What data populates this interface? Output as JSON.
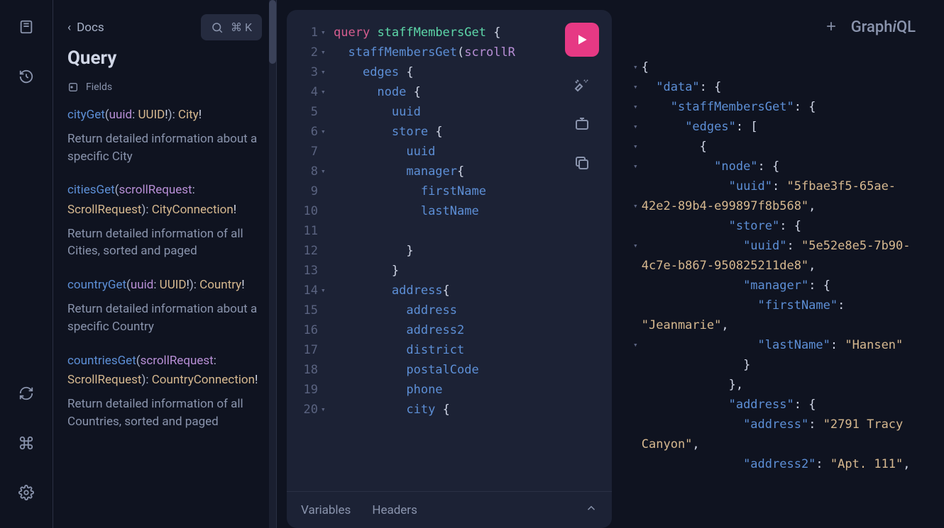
{
  "rail": {
    "items": [
      "book-icon",
      "history-icon"
    ],
    "bottom": [
      "refresh-icon",
      "command-icon",
      "gear-icon"
    ]
  },
  "docs": {
    "back_label": "Docs",
    "search_shortcut": "⌘ K",
    "title": "Query",
    "fields_label": "Fields",
    "entries": [
      {
        "name": "cityGet",
        "arg": "uuid",
        "argType": "UUID",
        "argBang": "!",
        "ret": "City",
        "retBang": "!",
        "desc": "Return detailed information about a specific City"
      },
      {
        "name": "citiesGet",
        "arg": "scrollRequest",
        "argType": "ScrollRequest",
        "argBang": "",
        "ret": "CityConnection",
        "retBang": "!",
        "desc": "Return detailed information of all Cities, sorted and paged"
      },
      {
        "name": "countryGet",
        "arg": "uuid",
        "argType": "UUID",
        "argBang": "!",
        "ret": "Country",
        "retBang": "!",
        "desc": "Return detailed information about a specific Country"
      },
      {
        "name": "countriesGet",
        "arg": "scrollRequest",
        "argType": "ScrollRequest",
        "argBang": "",
        "ret": "CountryConnection",
        "retBang": "!",
        "desc": "Return detailed information of all Countries, sorted and paged"
      }
    ]
  },
  "editor": {
    "lines": [
      {
        "n": 1,
        "fold": "▾",
        "html": "<span class='kw-query'>query</span> <span class='kw-name'>staffMembersGet</span> <span class='kw-brace'>{</span>"
      },
      {
        "n": 2,
        "fold": "▾",
        "html": "  <span class='kw-field'>staffMembersGet</span>(<span class='kw-arg'>scrollR</span>"
      },
      {
        "n": 3,
        "fold": "▾",
        "html": "    <span class='kw-field'>edges</span> <span class='kw-brace'>{</span>"
      },
      {
        "n": 4,
        "fold": "▾",
        "html": "      <span class='kw-field'>node</span> <span class='kw-brace'>{</span>"
      },
      {
        "n": 5,
        "fold": "",
        "html": "        <span class='kw-field'>uuid</span>"
      },
      {
        "n": 6,
        "fold": "▾",
        "html": "        <span class='kw-field'>store</span> <span class='kw-brace'>{</span>"
      },
      {
        "n": 7,
        "fold": "",
        "html": "          <span class='kw-field'>uuid</span>"
      },
      {
        "n": 8,
        "fold": "▾",
        "html": "          <span class='kw-field'>manager</span><span class='kw-brace'>{</span>"
      },
      {
        "n": 9,
        "fold": "",
        "html": "            <span class='kw-field'>firstName</span>"
      },
      {
        "n": 10,
        "fold": "",
        "html": "            <span class='kw-field'>lastName</span>"
      },
      {
        "n": 11,
        "fold": "",
        "html": ""
      },
      {
        "n": 12,
        "fold": "",
        "html": "          <span class='kw-brace'>}</span>"
      },
      {
        "n": 13,
        "fold": "",
        "html": "        <span class='kw-brace'>}</span>"
      },
      {
        "n": 14,
        "fold": "▾",
        "html": "        <span class='kw-field'>address</span><span class='kw-brace'>{</span>"
      },
      {
        "n": 15,
        "fold": "",
        "html": "          <span class='kw-field'>address</span>"
      },
      {
        "n": 16,
        "fold": "",
        "html": "          <span class='kw-field'>address2</span>"
      },
      {
        "n": 17,
        "fold": "",
        "html": "          <span class='kw-field'>district</span>"
      },
      {
        "n": 18,
        "fold": "",
        "html": "          <span class='kw-field'>postalCode</span>"
      },
      {
        "n": 19,
        "fold": "",
        "html": "          <span class='kw-field'>phone</span>"
      },
      {
        "n": 20,
        "fold": "▾",
        "html": "          <span class='kw-field'>city</span> <span class='kw-brace'>{</span>"
      }
    ],
    "tabs": {
      "variables": "Variables",
      "headers": "Headers"
    }
  },
  "result": {
    "brand": {
      "prefix": "Graph",
      "i": "i",
      "suffix": "QL"
    },
    "lines": [
      {
        "fold": "▾",
        "indent": 0,
        "html": "<span class='json-punc'>{</span>"
      },
      {
        "fold": "▾",
        "indent": 1,
        "html": "<span class='json-key'>\"data\"</span><span class='json-punc'>:</span> <span class='json-punc'>{</span>"
      },
      {
        "fold": "▾",
        "indent": 2,
        "html": "<span class='json-key'>\"staffMembersGet\"</span><span class='json-punc'>:</span> <span class='json-punc'>{</span>"
      },
      {
        "fold": "▾",
        "indent": 3,
        "html": "<span class='json-key'>\"edges\"</span><span class='json-punc'>:</span> <span class='json-punc'>[</span>"
      },
      {
        "fold": "▾",
        "indent": 4,
        "html": "<span class='json-punc'>{</span>"
      },
      {
        "fold": "▾",
        "indent": 5,
        "html": "<span class='json-key'>\"node\"</span><span class='json-punc'>:</span> <span class='json-punc'>{</span>"
      },
      {
        "fold": "",
        "indent": 6,
        "html": "<span class='json-key'>\"uuid\"</span><span class='json-punc'>:</span> <span class='json-str'>\"5fbae3f5-65ae-42e2-89b4-e99897f8b568\"</span><span class='json-punc'>,</span>"
      },
      {
        "fold": "▾",
        "indent": 6,
        "html": "<span class='json-key'>\"store\"</span><span class='json-punc'>:</span> <span class='json-punc'>{</span>"
      },
      {
        "fold": "",
        "indent": 7,
        "html": "<span class='json-key'>\"uuid\"</span><span class='json-punc'>:</span> <span class='json-str'>\"5e52e8e5-7b90-4c7e-b867-950825211de8\"</span><span class='json-punc'>,</span>"
      },
      {
        "fold": "▾",
        "indent": 7,
        "html": "<span class='json-key'>\"manager\"</span><span class='json-punc'>:</span> <span class='json-punc'>{</span>"
      },
      {
        "fold": "",
        "indent": 8,
        "html": "<span class='json-key'>\"firstName\"</span><span class='json-punc'>:</span> <span class='json-str'>\"Jeanmarie\"</span><span class='json-punc'>,</span>"
      },
      {
        "fold": "",
        "indent": 8,
        "html": "<span class='json-key'>\"lastName\"</span><span class='json-punc'>:</span> <span class='json-str'>\"Hansen\"</span>"
      },
      {
        "fold": "",
        "indent": 7,
        "html": "<span class='json-punc'>}</span>"
      },
      {
        "fold": "",
        "indent": 6,
        "html": "<span class='json-punc'>},</span>"
      },
      {
        "fold": "▾",
        "indent": 6,
        "html": "<span class='json-key'>\"address\"</span><span class='json-punc'>:</span> <span class='json-punc'>{</span>"
      },
      {
        "fold": "",
        "indent": 7,
        "html": "<span class='json-key'>\"address\"</span><span class='json-punc'>:</span> <span class='json-str'>\"2791 Tracy Canyon\"</span><span class='json-punc'>,</span>"
      },
      {
        "fold": "",
        "indent": 7,
        "html": "<span class='json-key'>\"address2\"</span><span class='json-punc'>:</span> <span class='json-str'>\"Apt. 111\"</span><span class='json-punc'>,</span>"
      }
    ]
  }
}
